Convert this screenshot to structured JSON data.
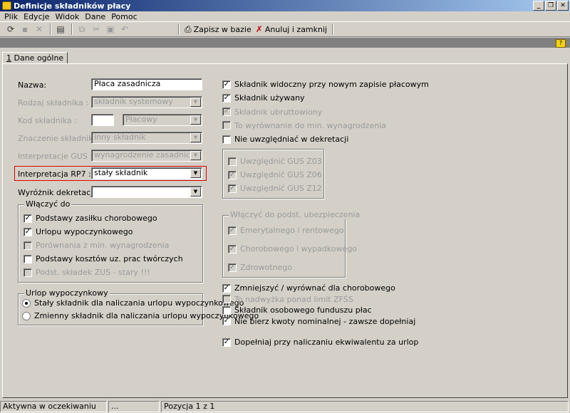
{
  "window": {
    "title": "Definicje składników płacy",
    "controls": [
      "_",
      "❐",
      "✕"
    ]
  },
  "menu": [
    "Plik",
    "Edycje",
    "Widok",
    "Dane",
    "Pomoc"
  ],
  "toolbar": {
    "save_label": "Zapisz w bazie",
    "cancel_label": "Anuluj i zamknij"
  },
  "tab": {
    "number": "1",
    "label": " Dane ogólne"
  },
  "form": {
    "nazwa_label": "Nazwa:",
    "nazwa_value": "Płaca zasadnicza",
    "rodzaj_label": "Rodzaj składnika :",
    "rodzaj_value": "składnik systemowy",
    "kod_label": "Kod składnika :",
    "kod_value": "",
    "kod_type_value": "Płacowy",
    "znaczenie_label": "Znaczenie składnika :",
    "znaczenie_value": "inny składnik",
    "gus_label": "Interpretacje GUS :",
    "gus_value": "wynagrodzenie zasadnicze",
    "rp7_label": "Interpretacja RP7 :",
    "rp7_value": "stały składnik",
    "wyroznik_label": "Wyróżnik dekretacji :",
    "wyroznik_value": ""
  },
  "wlaczyc_do": {
    "title": "Włączyć do",
    "items": [
      {
        "label": "Podstawy zasiłku chorobowego",
        "checked": true,
        "enabled": true
      },
      {
        "label": "Urlopu wypoczynkowego",
        "checked": true,
        "enabled": true
      },
      {
        "label": "Porównania z min. wynagrodzenia",
        "checked": false,
        "enabled": false
      },
      {
        "label": "Podstawy kosztów uz. prac twórczych",
        "checked": false,
        "enabled": true
      },
      {
        "label": "Podst. składek ZUS - stary !!!",
        "checked": false,
        "enabled": false
      }
    ]
  },
  "urlop": {
    "title": "Urlop wypoczynkowy",
    "options": [
      {
        "label": "Stały składnik dla naliczania urlopu wypoczynkowego",
        "selected": true
      },
      {
        "label": "Zmienny składnik dla naliczania urlopu wypoczynkowego",
        "selected": false
      }
    ]
  },
  "right_top": [
    {
      "label": "Składnik widoczny przy nowym zapisie płacowym",
      "checked": true,
      "enabled": true
    },
    {
      "label": "Składnik używany",
      "checked": true,
      "enabled": true
    },
    {
      "label": "Składnik ubruttowiony",
      "checked": true,
      "enabled": false
    },
    {
      "label": "To wyrównanie do min. wynagrodzenia",
      "checked": false,
      "enabled": false
    },
    {
      "label": "Nie uwzględniać w dekretacji",
      "checked": false,
      "enabled": true
    }
  ],
  "gus_group": [
    {
      "label": "Uwzględnić GUS Z03",
      "checked": false,
      "enabled": false
    },
    {
      "label": "Uwzględnić GUS Z06",
      "checked": true,
      "enabled": false
    },
    {
      "label": "Uwzględnić GUS Z12",
      "checked": true,
      "enabled": false
    }
  ],
  "ubezp": {
    "title": "Włączyć do podst. ubezpieczenia",
    "items": [
      {
        "label": "Emerytalnego i rentowego",
        "checked": true,
        "enabled": false
      },
      {
        "label": "Chorobowego i wypadkowego",
        "checked": true,
        "enabled": false
      },
      {
        "label": "Zdrowotnego",
        "checked": true,
        "enabled": false
      }
    ]
  },
  "right_bottom": [
    {
      "label": "Zmniejszyć / wyrównać dla chorobowego",
      "checked": true,
      "enabled": true
    },
    {
      "label": "To nadwyżka ponad limit ZFŚS",
      "checked": false,
      "enabled": false
    },
    {
      "label": "Składnik osobowego funduszu płac",
      "checked": false,
      "enabled": true
    },
    {
      "label": "Nie bierz kwoty nominalnej - zawsze dopełniaj",
      "checked": true,
      "enabled": true
    }
  ],
  "dopelniaj": {
    "label": "Dopełniaj przy naliczaniu ekwiwalentu za urlop",
    "checked": true,
    "enabled": true
  },
  "status": {
    "left": "Aktywna w oczekiwaniu",
    "middle": "...",
    "right": "Pozycja 1 z 1"
  }
}
